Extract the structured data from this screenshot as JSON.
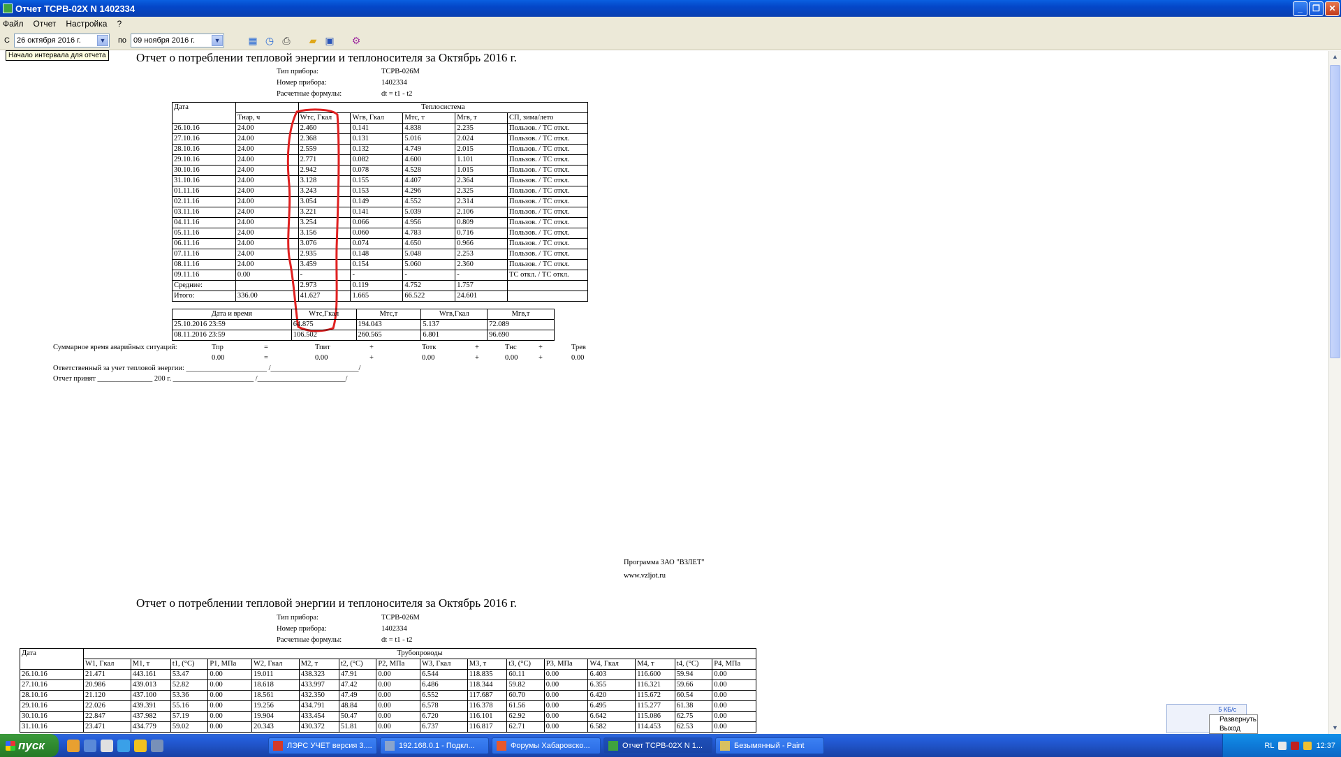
{
  "window": {
    "title": "Отчет ТСРВ-02Х N 1402334"
  },
  "menu": [
    "Файл",
    "Отчет",
    "Настройка",
    "?"
  ],
  "toolbar": {
    "from_label": "С",
    "from_date": "26  октября  2016 г.",
    "to_label": "по",
    "to_date": "09  ноября  2016 г.",
    "tooltip": "Начало интервала для отчета"
  },
  "report1": {
    "title": "Отчет о потреблении тепловой энергии и теплоносителя за Октябрь 2016 г.",
    "meta": [
      {
        "k": "Тип прибора:",
        "v": "ТСРВ-026М"
      },
      {
        "k": "Номер прибора:",
        "v": "1402334"
      },
      {
        "k": "Расчетные формулы:",
        "v": "dt = t1 - t2"
      }
    ],
    "table": {
      "date_header": "Дата",
      "group_header": "Теплосистема",
      "columns": [
        "Тнар, ч",
        "Wтс, Гкал",
        "Wгв, Гкал",
        "Мтс, т",
        "Мгв, т",
        "СП, зима/лето"
      ],
      "rows": [
        [
          "26.10.16",
          "24.00",
          "2.460",
          "0.141",
          "4.838",
          "2.235",
          "Пользов. / ТС откл."
        ],
        [
          "27.10.16",
          "24.00",
          "2.368",
          "0.131",
          "5.016",
          "2.024",
          "Пользов. / ТС откл."
        ],
        [
          "28.10.16",
          "24.00",
          "2.559",
          "0.132",
          "4.749",
          "2.015",
          "Пользов. / ТС откл."
        ],
        [
          "29.10.16",
          "24.00",
          "2.771",
          "0.082",
          "4.600",
          "1.101",
          "Пользов. / ТС откл."
        ],
        [
          "30.10.16",
          "24.00",
          "2.942",
          "0.078",
          "4.528",
          "1.015",
          "Пользов. / ТС откл."
        ],
        [
          "31.10.16",
          "24.00",
          "3.128",
          "0.155",
          "4.407",
          "2.364",
          "Пользов. / ТС откл."
        ],
        [
          "01.11.16",
          "24.00",
          "3.243",
          "0.153",
          "4.296",
          "2.325",
          "Пользов. / ТС откл."
        ],
        [
          "02.11.16",
          "24.00",
          "3.054",
          "0.149",
          "4.552",
          "2.314",
          "Пользов. / ТС откл."
        ],
        [
          "03.11.16",
          "24.00",
          "3.221",
          "0.141",
          "5.039",
          "2.106",
          "Пользов. / ТС откл."
        ],
        [
          "04.11.16",
          "24.00",
          "3.254",
          "0.066",
          "4.956",
          "0.809",
          "Пользов. / ТС откл."
        ],
        [
          "05.11.16",
          "24.00",
          "3.156",
          "0.060",
          "4.783",
          "0.716",
          "Пользов. / ТС откл."
        ],
        [
          "06.11.16",
          "24.00",
          "3.076",
          "0.074",
          "4.650",
          "0.966",
          "Пользов. / ТС откл."
        ],
        [
          "07.11.16",
          "24.00",
          "2.935",
          "0.148",
          "5.048",
          "2.253",
          "Пользов. / ТС откл."
        ],
        [
          "08.11.16",
          "24.00",
          "3.459",
          "0.154",
          "5.060",
          "2.360",
          "Пользов. / ТС откл."
        ],
        [
          "09.11.16",
          "0.00",
          "-",
          "-",
          "-",
          "-",
          "ТС откл. / ТС откл."
        ]
      ],
      "avg": [
        "Средние:",
        "",
        "2.973",
        "0.119",
        "4.752",
        "1.757",
        ""
      ],
      "total": [
        "Итого:",
        "336.00",
        "41.627",
        "1.665",
        "66.522",
        "24.601",
        ""
      ]
    },
    "counters": {
      "columns": [
        "Дата и время",
        "Wтс,Гкал",
        "Мтс,т",
        "Wгв,Гкал",
        "Мгв,т"
      ],
      "rows": [
        [
          "25.10.2016 23:59",
          "64.875",
          "194.043",
          "5.137",
          "72.089"
        ],
        [
          "08.11.2016 23:59",
          "106.502",
          "260.565",
          "6.801",
          "96.690"
        ]
      ]
    },
    "emergency": {
      "label": "Суммарное время аварийных ситуаций:",
      "names": [
        "Тпр",
        "=",
        "Тпит",
        "+",
        "Тотк",
        "+",
        "Тнс",
        "+",
        "Трев"
      ],
      "values": [
        "0.00",
        "=",
        "0.00",
        "+",
        "0.00",
        "+",
        "0.00",
        "+",
        "0.00"
      ]
    },
    "responsible": "Ответственный за учет тепловой энергии: ______________________  /________________________/",
    "accepted": "Отчет принят  _______________ 200  г.  ______________________  /________________________/",
    "program": "Программа ЗАО \"ВЗЛЕТ\"",
    "site": "www.vzljot.ru"
  },
  "report2": {
    "title": "Отчет о потреблении тепловой энергии и теплоносителя за Октябрь 2016 г.",
    "meta": [
      {
        "k": "Тип прибора:",
        "v": "ТСРВ-026М"
      },
      {
        "k": "Номер прибора:",
        "v": "1402334"
      },
      {
        "k": "Расчетные формулы:",
        "v": "dt = t1 - t2"
      }
    ],
    "table": {
      "date_header": "Дата",
      "group_header": "Трубопроводы",
      "columns": [
        "W1, Гкал",
        "M1, т",
        "t1, (°C)",
        "P1, МПа",
        "W2, Гкал",
        "M2, т",
        "t2, (°C)",
        "P2, МПа",
        "W3, Гкал",
        "M3, т",
        "t3, (°C)",
        "P3, МПа",
        "W4, Гкал",
        "M4, т",
        "t4, (°C)",
        "P4, МПа"
      ],
      "rows": [
        [
          "26.10.16",
          "21.471",
          "443.161",
          "53.47",
          "0.00",
          "19.011",
          "438.323",
          "47.91",
          "0.00",
          "6.544",
          "118.835",
          "60.11",
          "0.00",
          "6.403",
          "116.600",
          "59.94",
          "0.00"
        ],
        [
          "27.10.16",
          "20.986",
          "439.013",
          "52.82",
          "0.00",
          "18.618",
          "433.997",
          "47.42",
          "0.00",
          "6.486",
          "118.344",
          "59.82",
          "0.00",
          "6.355",
          "116.321",
          "59.66",
          "0.00"
        ],
        [
          "28.10.16",
          "21.120",
          "437.100",
          "53.36",
          "0.00",
          "18.561",
          "432.350",
          "47.49",
          "0.00",
          "6.552",
          "117.687",
          "60.70",
          "0.00",
          "6.420",
          "115.672",
          "60.54",
          "0.00"
        ],
        [
          "29.10.16",
          "22.026",
          "439.391",
          "55.16",
          "0.00",
          "19.256",
          "434.791",
          "48.84",
          "0.00",
          "6.578",
          "116.378",
          "61.56",
          "0.00",
          "6.495",
          "115.277",
          "61.38",
          "0.00"
        ],
        [
          "30.10.16",
          "22.847",
          "437.982",
          "57.19",
          "0.00",
          "19.904",
          "433.454",
          "50.47",
          "0.00",
          "6.720",
          "116.101",
          "62.92",
          "0.00",
          "6.642",
          "115.086",
          "62.75",
          "0.00"
        ],
        [
          "31.10.16",
          "23.471",
          "434.779",
          "59.02",
          "0.00",
          "20.343",
          "430.372",
          "51.81",
          "0.00",
          "6.737",
          "116.817",
          "62.71",
          "0.00",
          "6.582",
          "114.453",
          "62.53",
          "0.00"
        ]
      ]
    }
  },
  "taskbar": {
    "start": "пуск",
    "tasks": [
      {
        "label": "ЛЭРС УЧЕТ версия 3....",
        "color": "#d23a2a"
      },
      {
        "label": "192.168.0.1 - Подкл...",
        "color": "#8aa4cc"
      },
      {
        "label": "Форумы Хабаровско...",
        "color": "#e8582c"
      },
      {
        "label": "Отчет ТСРВ-02Х N 1...",
        "color": "#3fa23f"
      },
      {
        "label": "Безымянный - Paint",
        "color": "#d8c060"
      }
    ],
    "lang": "RL",
    "clock": "12:37",
    "speed": "5 КБ/с",
    "popup_menu": [
      "Развернуть",
      "Выход"
    ]
  }
}
